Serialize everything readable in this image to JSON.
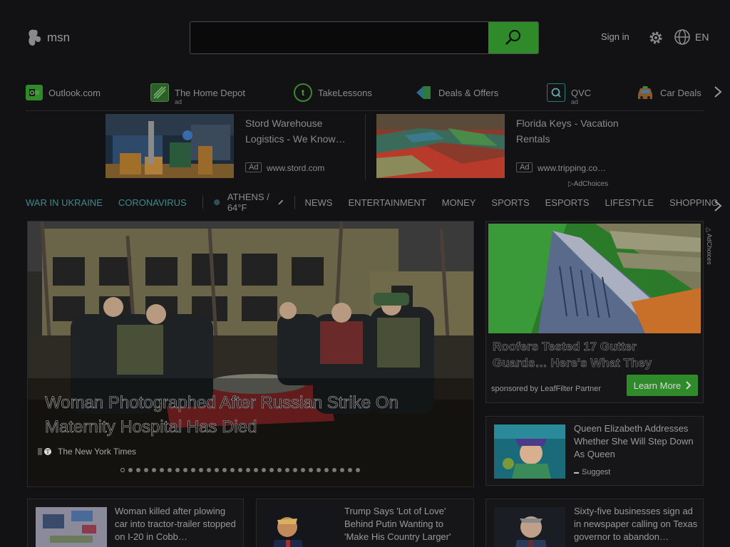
{
  "header": {
    "logo_text": "msn",
    "search": {
      "placeholder": "",
      "value": ""
    },
    "signin_label": "Sign in",
    "language": "EN"
  },
  "quick_links": [
    {
      "label": "Outlook.com",
      "sub": "",
      "icon": "outlook-icon",
      "color": "#2f8a2a"
    },
    {
      "label": "The Home Depot",
      "sub": "ad",
      "icon": "home-depot-icon",
      "color": "#3a7a36"
    },
    {
      "label": "TakeLessons",
      "sub": "",
      "icon": "takelessons-icon",
      "color": "#3a8a2a"
    },
    {
      "label": "Deals & Offers",
      "sub": "",
      "icon": "deals-icon",
      "color": "#2a6a8a"
    },
    {
      "label": "QVC",
      "sub": "ad",
      "icon": "qvc-icon",
      "color": "#2a7a7a"
    },
    {
      "label": "Car Deals",
      "sub": "",
      "icon": "car-icon",
      "color": "#8a6a2a"
    }
  ],
  "ads": [
    {
      "title": "Stord Warehouse Logistics - We Know…",
      "badge": "Ad",
      "url": "www.stord.com"
    },
    {
      "title": "Florida Keys - Vacation Rentals",
      "badge": "Ad",
      "url": "www.tripping.co…"
    }
  ],
  "adchoices_label": "AdChoices",
  "categories": {
    "highlight": [
      "WAR IN UKRAINE",
      "CORONAVIRUS"
    ],
    "weather": "ATHENS / 64°F",
    "sections": [
      "NEWS",
      "ENTERTAINMENT",
      "MONEY",
      "SPORTS",
      "ESPORTS",
      "LIFESTYLE",
      "SHOPPING"
    ]
  },
  "hero": {
    "title": "Woman Photographed After Russian Strike On Maternity Hospital Has Died",
    "source": "The New York Times",
    "slide_count": 31,
    "active_slide": 1
  },
  "right_ad": {
    "title": "Roofers Tested 17 Gutter Guards… Here's What They",
    "sponsor": "sponsored by LeafFilter Partner",
    "button_label": "Learn More"
  },
  "side_card": {
    "title": "Queen Elizabeth Addresses Whether She Will Step Down As Queen",
    "source": "Suggest"
  },
  "bottom_cards": [
    {
      "title": "Woman killed after plowing car into tractor-trailer stopped on I-20 in Cobb…"
    },
    {
      "title": "Trump Says 'Lot of Love' Behind Putin Wanting to 'Make His Country Larger'"
    },
    {
      "title": "Sixty-five businesses sign ad in newspaper calling on Texas governor to abandon…"
    }
  ],
  "colors": {
    "accent": "#2f8a2a",
    "teal": "#3f8a8a",
    "background": "#121215"
  }
}
